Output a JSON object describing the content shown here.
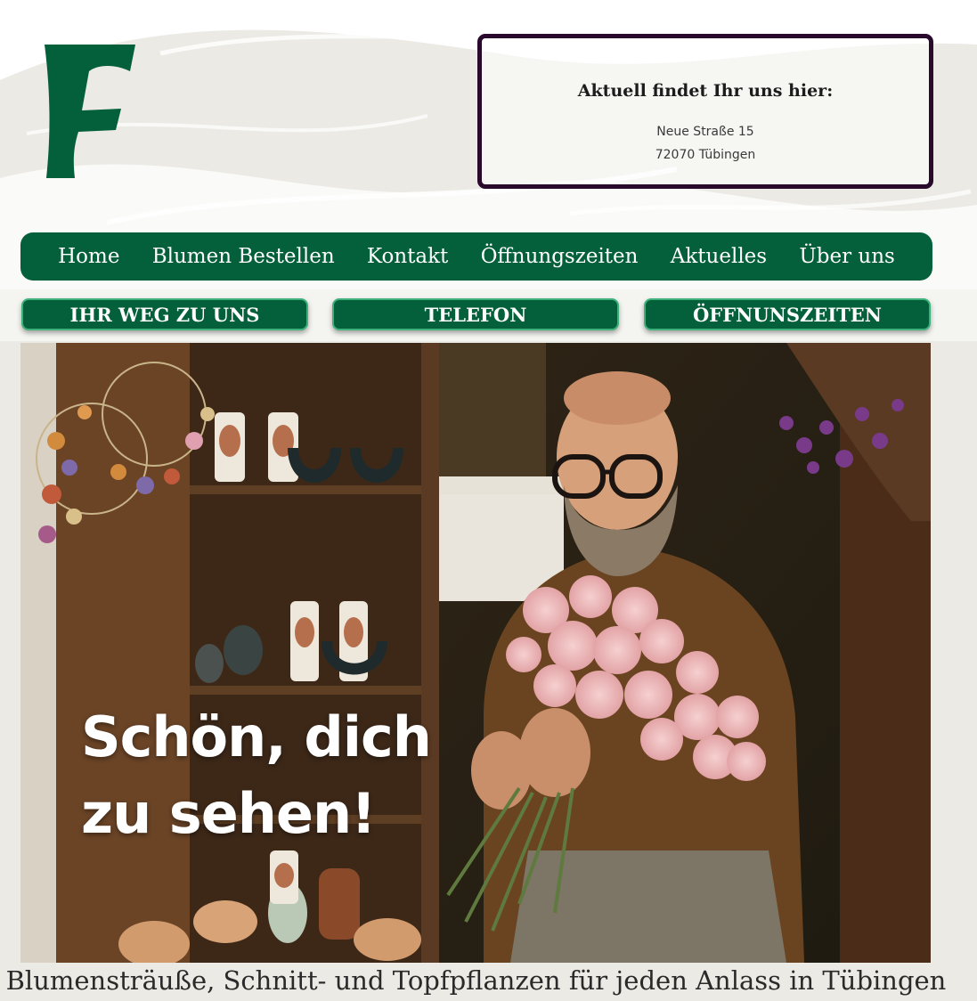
{
  "header": {
    "logo_icon": "f-letter-logo",
    "brand_color": "#04603a"
  },
  "address": {
    "title": "Aktuell findet Ihr uns hier:",
    "street": "Neue Straße 15",
    "city": "72070 Tübingen",
    "border_color": "#2a0a2c"
  },
  "nav": {
    "items": [
      {
        "label": "Home"
      },
      {
        "label": "Blumen Bestellen"
      },
      {
        "label": "Kontakt"
      },
      {
        "label": "Öffnungszeiten"
      },
      {
        "label": "Aktuelles"
      },
      {
        "label": "Über uns"
      }
    ]
  },
  "quick_links": [
    {
      "label": "IHR WEG ZU UNS"
    },
    {
      "label": "TELEFON"
    },
    {
      "label": "ÖFFNUNSZEITEN"
    }
  ],
  "hero": {
    "line1": "Schön, dich",
    "line2": "zu sehen!"
  },
  "tagline": "Blumensträuße, Schnitt- und Topfpflanzen für jeden Anlass in Tübingen"
}
